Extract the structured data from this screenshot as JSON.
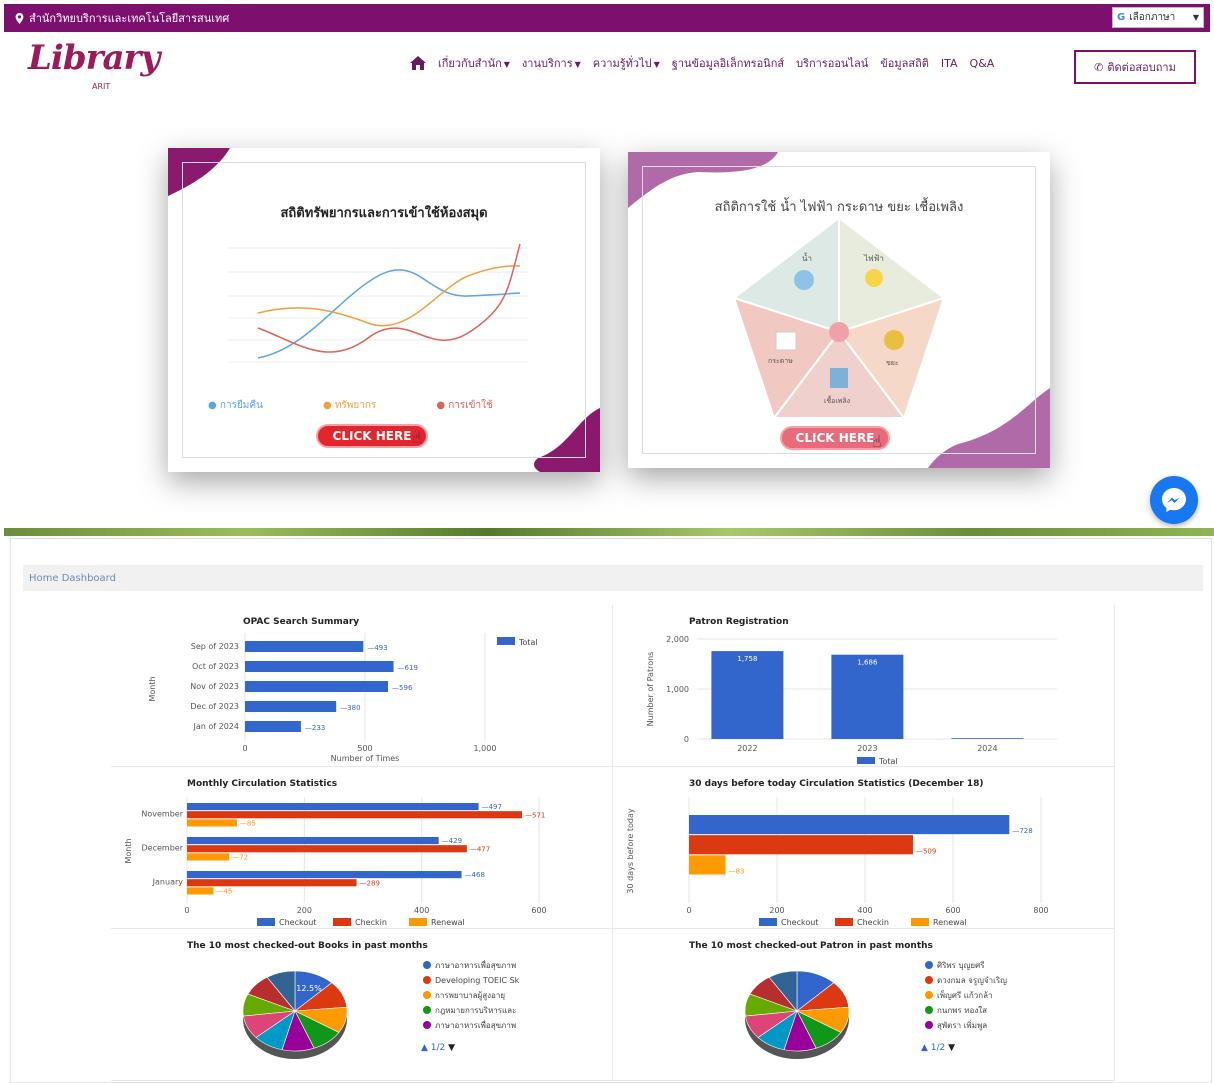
{
  "topbar": {
    "address": "สำนักวิทยบริการและเทคโนโลยีสารสนเทศ",
    "translate_label": "เลือกภาษา"
  },
  "logo": {
    "word": "Library",
    "sub": "ARIT"
  },
  "nav": {
    "items": [
      {
        "label": "เกี่ยวกับสำนัก",
        "dropdown": true
      },
      {
        "label": "งานบริการ",
        "dropdown": true
      },
      {
        "label": "ความรู้ทั่วไป",
        "dropdown": true
      },
      {
        "label": "ฐานข้อมูลอิเล็กทรอนิกส์",
        "dropdown": false
      },
      {
        "label": "บริการออนไลน์",
        "dropdown": false
      },
      {
        "label": "ข้อมูลสถิติ",
        "dropdown": false
      },
      {
        "label": "ITA",
        "dropdown": false
      },
      {
        "label": "Q&A",
        "dropdown": false
      }
    ],
    "contact_label": "ติดต่อสอบถาม"
  },
  "cards": [
    {
      "title": "สถิติทรัพยากรและการเข้าใช้ห้องสมุด",
      "legend": [
        "การยืมคืน",
        "ทรัพยากร",
        "การเข้าใช้"
      ],
      "button": "CLICK HERE"
    },
    {
      "title": "สถิติการใช้ น้ำ ไฟฟ้า กระดาษ ขยะ เชื้อเพลิง",
      "segments": [
        "น้ำ",
        "ไฟฟ้า",
        "กระดาษ",
        "ขยะ",
        "เชื้อเพลิง"
      ],
      "button": "CLICK HERE"
    }
  ],
  "dashboard": {
    "title": "Home Dashboard",
    "opac": {
      "title": "OPAC Search Summary",
      "categories": [
        "Sep of 2023",
        "Oct of 2023",
        "Nov of 2023",
        "Dec of 2023",
        "Jan of 2024"
      ],
      "values": [
        493,
        619,
        596,
        380,
        233
      ],
      "xmax": 1000,
      "ticks": [
        "0",
        "500",
        "1,000"
      ],
      "xlabel": "Number of Times",
      "ylabel": "Month",
      "legend": "Total",
      "color": "#3366cc"
    },
    "patron_reg": {
      "title": "Patron Registration",
      "categories": [
        "2022",
        "2023",
        "2024"
      ],
      "values": [
        1758,
        1686,
        16
      ],
      "value_labels": [
        "1,758",
        "1,686",
        ""
      ],
      "ymax": 2000,
      "ticks": [
        "0",
        "1,000",
        "2,000"
      ],
      "ylabel": "Number of Patrons",
      "legend": "Total",
      "color": "#3366cc"
    },
    "monthly": {
      "title": "Monthly Circulation Statistics",
      "categories": [
        "November",
        "December",
        "January"
      ],
      "series": [
        {
          "name": "Checkout",
          "color": "#3366cc",
          "values": [
            497,
            429,
            468
          ]
        },
        {
          "name": "Checkin",
          "color": "#dc3912",
          "values": [
            571,
            477,
            289
          ]
        },
        {
          "name": "Renewal",
          "color": "#ff9900",
          "values": [
            85,
            72,
            45
          ]
        }
      ],
      "xmax": 600,
      "ticks": [
        "0",
        "200",
        "400",
        "600"
      ],
      "ylabel": "Month"
    },
    "daily": {
      "title": "30 days before today Circulation Statistics (December 18)",
      "categories": [
        ""
      ],
      "series": [
        {
          "name": "Checkout",
          "color": "#3366cc",
          "values": [
            728
          ]
        },
        {
          "name": "Checkin",
          "color": "#dc3912",
          "values": [
            509
          ]
        },
        {
          "name": "Renewal",
          "color": "#ff9900",
          "values": [
            83
          ]
        }
      ],
      "xmax": 800,
      "ticks": [
        "0",
        "200",
        "400",
        "600",
        "800"
      ],
      "ylabel": "30 days before today"
    },
    "top_books": {
      "title": "The 10 most checked-out Books in past months",
      "legend": [
        "ภาษาอาหารเพื่อสุขภาพ",
        "Developing TOEIC Sk",
        "การพยาบาลผู้สูงอายุ",
        "กฎหมายการบริหารและ",
        "ภาษาอาหารเพื่อสุขภาพ"
      ],
      "highlight_label": "12.5%",
      "pager": "1/2"
    },
    "top_patrons": {
      "title": "The 10 most checked-out Patron in past months",
      "legend": [
        "ศิริพร บุญยศรี",
        "ดวงกมล จรูญจำเริญ",
        "เพ็ญศรี แก้วกล้า",
        "กนกพร ทองใส",
        "สุพัตรา เพิ่มพูล"
      ],
      "pager": "1/2"
    },
    "pie_colors": [
      "#3366cc",
      "#dc3912",
      "#ff9900",
      "#109618",
      "#990099",
      "#0099c6",
      "#dd4477",
      "#66aa00",
      "#b82e2e",
      "#316395"
    ]
  }
}
